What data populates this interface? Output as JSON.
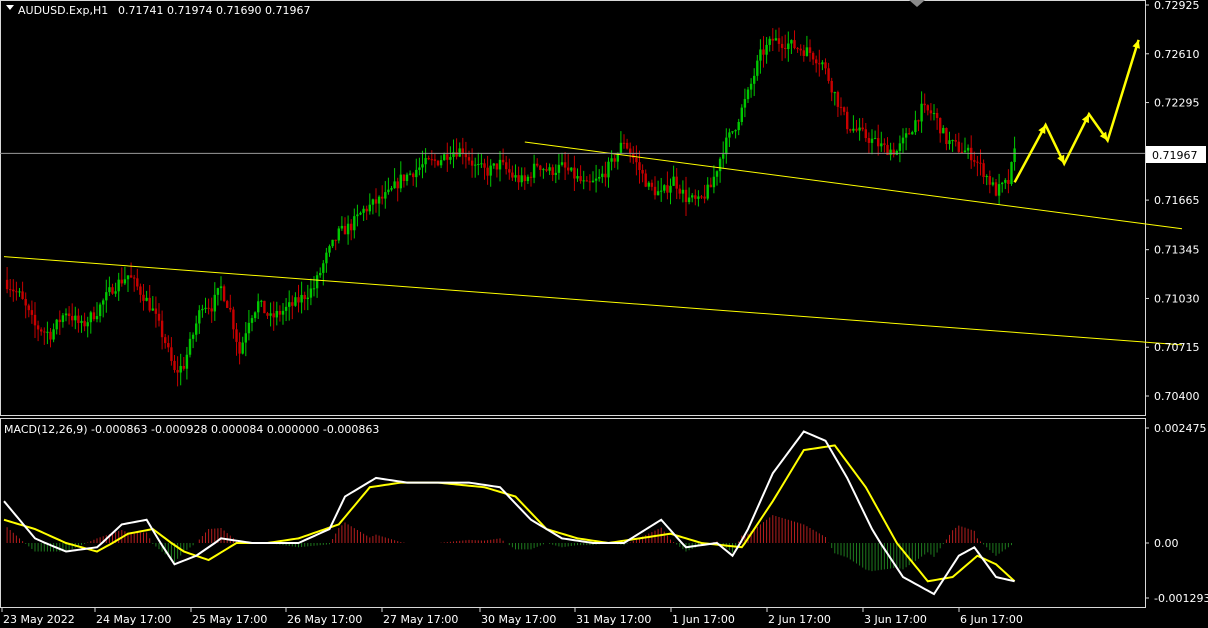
{
  "colors": {
    "background": "#000000",
    "frame": "#d8d8d8",
    "bull_candle": "#00c800",
    "bear_candle": "#c80000",
    "trendline": "#ffff00",
    "arrows": "#ffff00",
    "macd_line": "#ffffff",
    "signal_line": "#ffff00",
    "histogram_up": "#b41e1e",
    "histogram_down": "#1e7a1e",
    "price_line": "#9a9a9a"
  },
  "header": {
    "symbol": "AUDUSD.Exp,H1",
    "ohlc": "0.71741 0.71974 0.71690 0.71967"
  },
  "macd_header": "MACD(12,26,9) -0.000863 -0.000928 0.000084 0.000000 -0.000863",
  "price_axis_labels": [
    "0.72925",
    "0.72610",
    "0.72295",
    "0.71967",
    "0.71665",
    "0.71345",
    "0.71030",
    "0.70715",
    "0.70400"
  ],
  "current_price": "0.71967",
  "macd_axis_labels": [
    "0.002475",
    "0.00",
    "-0.001293"
  ],
  "time_labels": [
    "23 May 2022",
    "24 May 17:00",
    "25 May 17:00",
    "26 May 17:00",
    "27 May 17:00",
    "30 May 17:00",
    "31 May 17:00",
    "1 Jun 17:00",
    "2 Jun 17:00",
    "3 Jun 17:00",
    "6 Jun 17:00"
  ],
  "chart_data": [
    {
      "type": "candlestick",
      "title": "AUDUSD.Exp,H1",
      "ylim": [
        0.7025,
        0.7305
      ],
      "current_price": 0.71967,
      "x_ticks": [
        "23 May 2022",
        "24 May 17:00",
        "25 May 17:00",
        "26 May 17:00",
        "27 May 17:00",
        "30 May 17:00",
        "31 May 17:00",
        "1 Jun 17:00",
        "2 Jun 17:00",
        "3 Jun 17:00",
        "6 Jun 17:00"
      ],
      "close_path": [
        [
          0,
          0.7115
        ],
        [
          5,
          0.7105
        ],
        [
          10,
          0.7085
        ],
        [
          15,
          0.708
        ],
        [
          20,
          0.7095
        ],
        [
          25,
          0.7085
        ],
        [
          30,
          0.7095
        ],
        [
          35,
          0.711
        ],
        [
          40,
          0.7118
        ],
        [
          45,
          0.7105
        ],
        [
          48,
          0.7095
        ],
        [
          52,
          0.7075
        ],
        [
          55,
          0.7055
        ],
        [
          58,
          0.706
        ],
        [
          61,
          0.708
        ],
        [
          64,
          0.71
        ],
        [
          67,
          0.7098
        ],
        [
          70,
          0.711
        ],
        [
          73,
          0.7095
        ],
        [
          76,
          0.7068
        ],
        [
          79,
          0.709
        ],
        [
          82,
          0.71
        ],
        [
          86,
          0.709
        ],
        [
          90,
          0.7095
        ],
        [
          94,
          0.71
        ],
        [
          97,
          0.7105
        ],
        [
          100,
          0.711
        ],
        [
          104,
          0.713
        ],
        [
          108,
          0.7145
        ],
        [
          112,
          0.715
        ],
        [
          116,
          0.716
        ],
        [
          120,
          0.7165
        ],
        [
          124,
          0.717
        ],
        [
          128,
          0.718
        ],
        [
          132,
          0.7185
        ],
        [
          136,
          0.719
        ],
        [
          140,
          0.7192
        ],
        [
          144,
          0.7198
        ],
        [
          148,
          0.7199
        ],
        [
          152,
          0.7188
        ],
        [
          156,
          0.7185
        ],
        [
          160,
          0.719
        ],
        [
          164,
          0.7182
        ],
        [
          168,
          0.7178
        ],
        [
          172,
          0.719
        ],
        [
          176,
          0.7185
        ],
        [
          180,
          0.7188
        ],
        [
          184,
          0.7182
        ],
        [
          188,
          0.7175
        ],
        [
          192,
          0.718
        ],
        [
          196,
          0.719
        ],
        [
          200,
          0.7205
        ],
        [
          204,
          0.719
        ],
        [
          208,
          0.7175
        ],
        [
          212,
          0.717
        ],
        [
          216,
          0.718
        ],
        [
          220,
          0.7168
        ],
        [
          224,
          0.7165
        ],
        [
          228,
          0.7175
        ],
        [
          232,
          0.72
        ],
        [
          236,
          0.7215
        ],
        [
          240,
          0.7235
        ],
        [
          244,
          0.726
        ],
        [
          248,
          0.727
        ],
        [
          252,
          0.7268
        ],
        [
          256,
          0.7265
        ],
        [
          260,
          0.7262
        ],
        [
          264,
          0.7255
        ],
        [
          268,
          0.7235
        ],
        [
          272,
          0.7215
        ],
        [
          276,
          0.721
        ],
        [
          280,
          0.7205
        ],
        [
          284,
          0.72
        ],
        [
          288,
          0.7198
        ],
        [
          292,
          0.721
        ],
        [
          296,
          0.7225
        ],
        [
          300,
          0.7222
        ],
        [
          304,
          0.7205
        ],
        [
          308,
          0.72
        ],
        [
          312,
          0.7196
        ],
        [
          316,
          0.7185
        ],
        [
          320,
          0.7172
        ],
        [
          324,
          0.7178
        ],
        [
          326,
          0.7197
        ]
      ],
      "trendlines": [
        {
          "from": [
            0,
            0.713
          ],
          "to": [
            380,
            0.7073
          ]
        },
        {
          "from": [
            168,
            0.7204
          ],
          "to": [
            380,
            0.7148
          ]
        }
      ],
      "projection_arrow_path": [
        [
          326,
          0.7178
        ],
        [
          336,
          0.7215
        ],
        [
          342,
          0.719
        ],
        [
          350,
          0.7222
        ],
        [
          356,
          0.7205
        ],
        [
          366,
          0.727
        ]
      ]
    },
    {
      "type": "line",
      "title": "MACD(12,26,9)",
      "ylim": [
        -0.001293,
        0.002475
      ],
      "values": {
        "macd": -0.000863,
        "signal": -0.000928,
        "histogram": 8.4e-05
      },
      "macd_path": [
        [
          0,
          0.0009
        ],
        [
          10,
          0.0001
        ],
        [
          20,
          -0.0002
        ],
        [
          30,
          -0.0001
        ],
        [
          38,
          0.0004
        ],
        [
          46,
          0.0005
        ],
        [
          55,
          -0.0005
        ],
        [
          62,
          -0.0003
        ],
        [
          70,
          0.0001
        ],
        [
          80,
          0.0
        ],
        [
          95,
          0.0
        ],
        [
          105,
          0.0003
        ],
        [
          110,
          0.001
        ],
        [
          120,
          0.0014
        ],
        [
          130,
          0.0013
        ],
        [
          140,
          0.0013
        ],
        [
          150,
          0.0013
        ],
        [
          160,
          0.0012
        ],
        [
          170,
          0.0005
        ],
        [
          180,
          0.0001
        ],
        [
          190,
          -0.0
        ],
        [
          200,
          0.0
        ],
        [
          212,
          0.0005
        ],
        [
          220,
          -0.0001
        ],
        [
          230,
          0.0
        ],
        [
          235,
          -0.0003
        ],
        [
          240,
          0.0003
        ],
        [
          248,
          0.0015
        ],
        [
          258,
          0.0024
        ],
        [
          265,
          0.0022
        ],
        [
          272,
          0.0014
        ],
        [
          280,
          0.0003
        ],
        [
          290,
          -0.0008
        ],
        [
          300,
          -0.0012
        ],
        [
          308,
          -0.0003
        ],
        [
          313,
          -0.0001
        ],
        [
          320,
          -0.0008
        ],
        [
          326,
          -0.0009
        ]
      ],
      "signal_path": [
        [
          0,
          0.0005
        ],
        [
          10,
          0.0003
        ],
        [
          20,
          0.0
        ],
        [
          30,
          -0.0002
        ],
        [
          40,
          0.0002
        ],
        [
          48,
          0.0003
        ],
        [
          58,
          -0.0002
        ],
        [
          66,
          -0.0004
        ],
        [
          75,
          0.0
        ],
        [
          85,
          0.0
        ],
        [
          95,
          0.0001
        ],
        [
          108,
          0.0004
        ],
        [
          118,
          0.0012
        ],
        [
          128,
          0.0013
        ],
        [
          140,
          0.0013
        ],
        [
          155,
          0.0012
        ],
        [
          165,
          0.001
        ],
        [
          175,
          0.0003
        ],
        [
          185,
          0.0001
        ],
        [
          195,
          0.0
        ],
        [
          205,
          0.0001
        ],
        [
          215,
          0.0002
        ],
        [
          225,
          0.0
        ],
        [
          238,
          -0.0001
        ],
        [
          248,
          0.0009
        ],
        [
          258,
          0.002
        ],
        [
          268,
          0.0021
        ],
        [
          278,
          0.0012
        ],
        [
          288,
          0.0
        ],
        [
          298,
          -0.0009
        ],
        [
          306,
          -0.0008
        ],
        [
          314,
          -0.0003
        ],
        [
          320,
          -0.0005
        ],
        [
          326,
          -0.0009
        ]
      ]
    }
  ]
}
